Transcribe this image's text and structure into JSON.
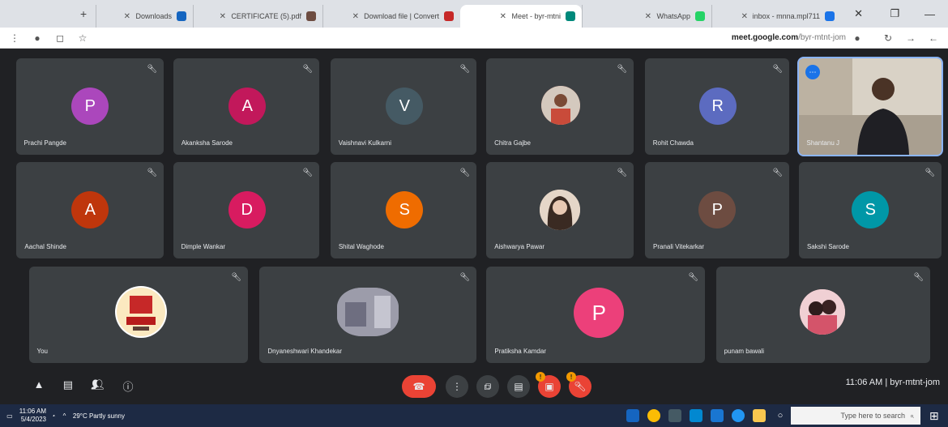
{
  "browser": {
    "tabs": [
      {
        "title": "inbox - mnna.mpl711",
        "color": "#1a73e8",
        "active": false
      },
      {
        "title": "WhatsApp",
        "color": "#25d366",
        "active": false
      },
      {
        "title": "Meet - byr-mtni",
        "color": "#00897b",
        "active": true
      },
      {
        "title": "Download file | Convert",
        "color": "#c62828",
        "active": false
      },
      {
        "title": "CERTIFICATE (5).pdf",
        "color": "#6d4c41",
        "active": false
      },
      {
        "title": "Downloads",
        "color": "#1565c0",
        "active": false
      }
    ],
    "url_host": "meet.google.com",
    "url_path": "/byr-mtnt-jom"
  },
  "meeting": {
    "time": "11:06 AM",
    "separator": "|",
    "code": "byr-mtnt-jom"
  },
  "participants": [
    {
      "name": "Shantanu J",
      "type": "video",
      "speaking": true
    },
    {
      "name": "Rohit Chawda",
      "type": "initial",
      "initial": "R",
      "color": "#5c6bc0"
    },
    {
      "name": "Chitra Gajbe",
      "type": "photo",
      "color": "#c94b3a"
    },
    {
      "name": "Vaishnavi Kulkarni",
      "type": "initial",
      "initial": "V",
      "color": "#455a64"
    },
    {
      "name": "Akanksha Sarode",
      "type": "initial",
      "initial": "A",
      "color": "#c2185b"
    },
    {
      "name": "Prachi Pangde",
      "type": "initial",
      "initial": "P",
      "color": "#ab47bc"
    },
    {
      "name": "Sakshi Sarode",
      "type": "initial",
      "initial": "S",
      "color": "#0097a7"
    },
    {
      "name": "Pranali Vitekarkar",
      "type": "initial",
      "initial": "P",
      "color": "#6d4c41"
    },
    {
      "name": "Aishwarya Pawar",
      "type": "photo",
      "color": "#d9c2b0"
    },
    {
      "name": "Shital Waghode",
      "type": "initial",
      "initial": "S",
      "color": "#ef6c00"
    },
    {
      "name": "Dimple Wankar",
      "type": "initial",
      "initial": "D",
      "color": "#d81b60"
    },
    {
      "name": "Aachal Shinde",
      "type": "initial",
      "initial": "A",
      "color": "#bf360c"
    },
    {
      "name": "punam bawali",
      "type": "photo",
      "color": "#e8a0a8"
    },
    {
      "name": "Pratiksha Kamdar",
      "type": "initial",
      "initial": "P",
      "color": "#ec407a"
    },
    {
      "name": "Dnyaneshwari Khandekar",
      "type": "photo",
      "color": "#8a8a9a"
    },
    {
      "name": "You",
      "type": "photo",
      "color": "#ffffff"
    }
  ],
  "taskbar": {
    "search_placeholder": "Type here to search",
    "weather": "29°C Partly sunny",
    "time": "11:06 AM",
    "date": "5/4/2023"
  },
  "icons": {
    "mic_off": "mic-off-icon",
    "more": "more-vert-icon",
    "end_call": "call-end-icon"
  }
}
